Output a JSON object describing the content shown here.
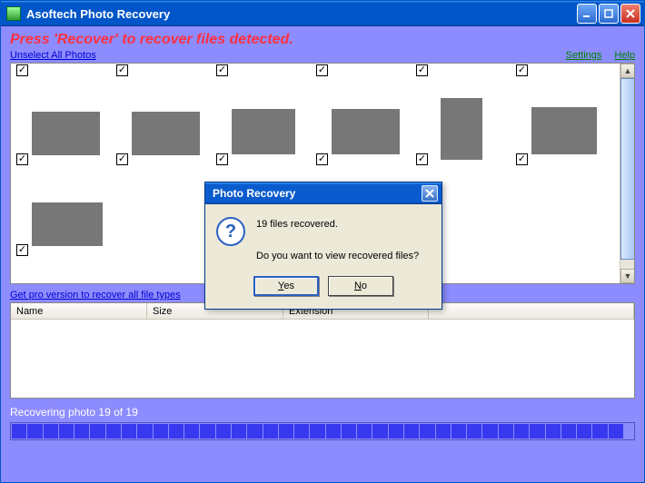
{
  "window": {
    "title": "Asoftech Photo Recovery"
  },
  "instruction": "Press 'Recover' to recover files detected.",
  "links": {
    "unselect": "Unselect All Photos",
    "settings": "Settings",
    "help": "Help",
    "pro": "Get pro version to recover all file types"
  },
  "grid": {
    "cols": {
      "name": "Name",
      "size": "Size",
      "ext": "Extension"
    }
  },
  "status": "Recovering photo 19 of 19",
  "dialog": {
    "title": "Photo Recovery",
    "line1": "19 files recovered.",
    "line2": "Do you want to view recovered files?",
    "yes": "Yes",
    "no": "No"
  },
  "thumbs": {
    "row1_count": 6,
    "row2_count": 6,
    "row3_count": 1
  }
}
